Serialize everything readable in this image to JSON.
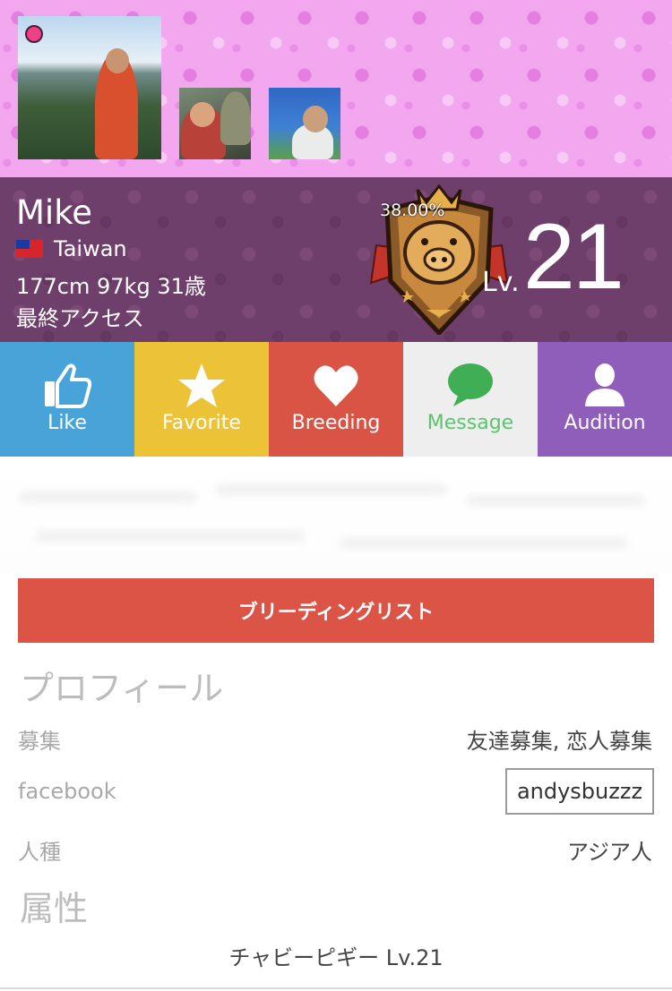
{
  "user": {
    "name": "Mike",
    "country": "Taiwan",
    "stats": "177cm 97kg 31歳",
    "last_access": "最終アクセス"
  },
  "level": {
    "progress_text": "38.00%",
    "progress_value": 38.0,
    "label": "Lv.",
    "number": "21"
  },
  "actions": [
    {
      "label": "Like",
      "icon": "thumbs-up-icon"
    },
    {
      "label": "Favorite",
      "icon": "star-icon"
    },
    {
      "label": "Breeding",
      "icon": "heart-icon"
    },
    {
      "label": "Message",
      "icon": "chat-bubble-icon"
    },
    {
      "label": "Audition",
      "icon": "person-icon"
    }
  ],
  "breeding_list_button": "ブリーディングリスト",
  "profile": {
    "title": "プロフィール",
    "rows": [
      {
        "label": "募集",
        "value": "友達募集, 恋人募集"
      },
      {
        "label": "facebook",
        "value": "andysbuzzz"
      },
      {
        "label": "人種",
        "value": "アジア人"
      }
    ]
  },
  "attributes": {
    "title": "属性",
    "value": "チャビーピギー Lv.21"
  },
  "colors": {
    "like": "#48a3d9",
    "favorite": "#ecc336",
    "breeding": "#d95445",
    "message": "#eeeeee",
    "message_text": "#5cc46c",
    "audition": "#8f5dba",
    "header_pink": "#f2a7ee",
    "band_purple": "#6e3f6a",
    "online_dot": "#ef3f86"
  }
}
